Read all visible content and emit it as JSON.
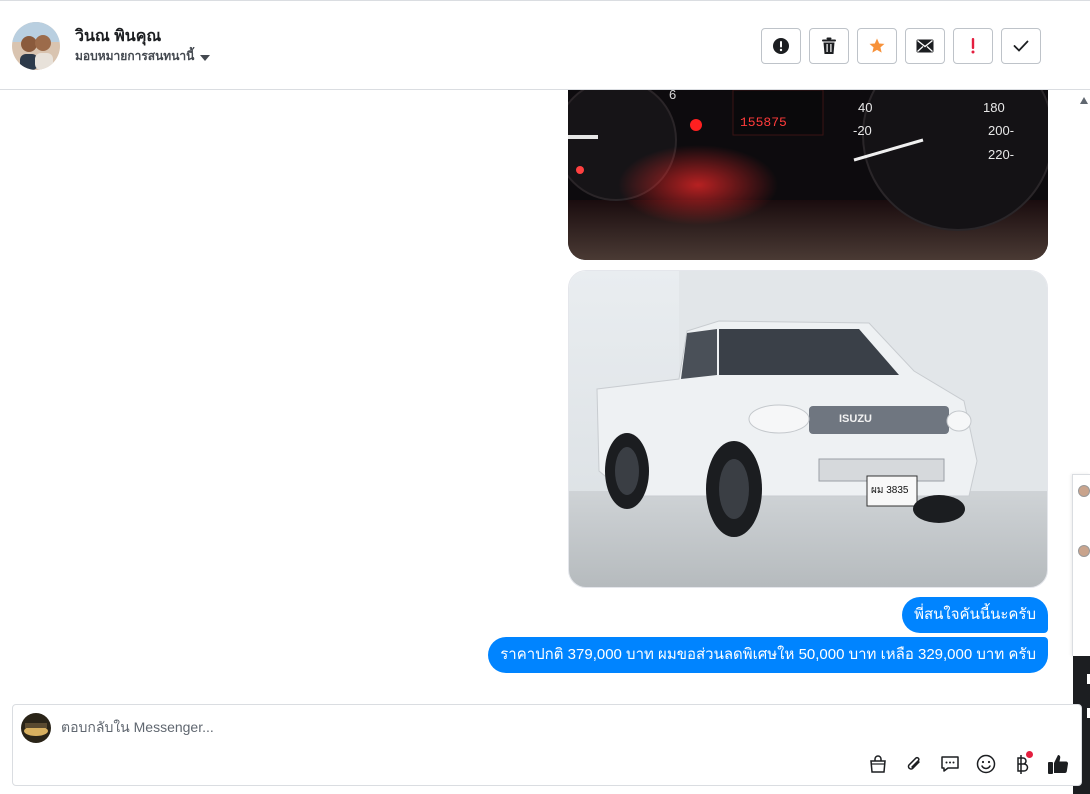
{
  "header": {
    "contact_name": "วินณ พินคุณ",
    "assign_label": "มอบหมายการสนทนานี้",
    "actions": [
      {
        "name": "report-spam-button",
        "icon": "exclamation-circle-icon"
      },
      {
        "name": "delete-button",
        "icon": "trash-icon"
      },
      {
        "name": "star-button",
        "icon": "star-icon"
      },
      {
        "name": "mark-unread-button",
        "icon": "envelope-icon"
      },
      {
        "name": "follow-up-button",
        "icon": "exclamation-icon"
      },
      {
        "name": "mark-done-button",
        "icon": "checkmark-icon"
      }
    ]
  },
  "conversation": {
    "images": [
      {
        "name": "dashboard-photo",
        "odometer": "155875"
      },
      {
        "name": "pickup-truck-photo",
        "brand_badge": "ISUZU",
        "plate": "ผม 3835"
      }
    ],
    "messages": [
      {
        "text": "พี่สนใจคันนี้นะครับ"
      },
      {
        "text": "ราคาปกติ 379,000 บาท ผมขอส่วนลดพิเศษให 50,000 บาท เหลือ 329,000 บาท ครับ"
      }
    ]
  },
  "composer": {
    "placeholder": "ตอบกลับใน Messenger..."
  },
  "colors": {
    "bubble": "#0084ff",
    "star": "#f7923b",
    "alert_red": "#e41e3f",
    "border": "#dadde1"
  }
}
